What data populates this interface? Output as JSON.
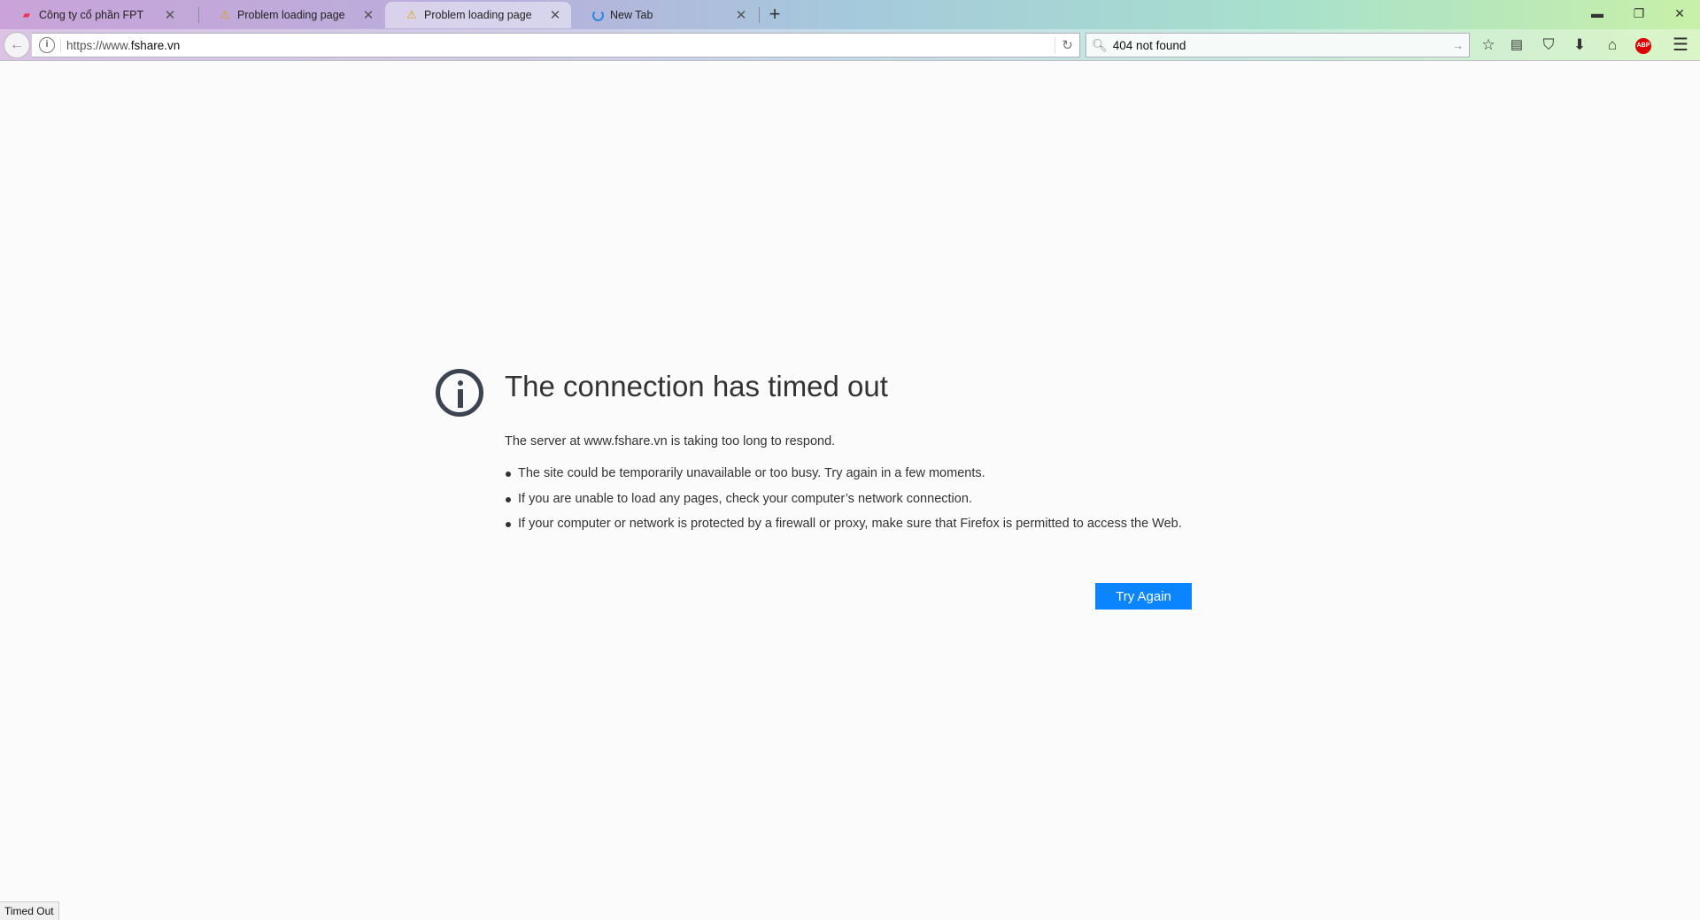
{
  "tabs": [
    {
      "label": "Công ty cổ phần FPT",
      "icon": "fpt-favicon",
      "active": false
    },
    {
      "label": "Problem loading page",
      "icon": "warning-icon",
      "active": false
    },
    {
      "label": "Problem loading page",
      "icon": "warning-icon",
      "active": true
    },
    {
      "label": "New Tab",
      "icon": "loading-spinner-icon",
      "active": false
    }
  ],
  "toolbar": {
    "url_prefix": "https://www.",
    "url_domain": "fshare.vn",
    "search_value": "404 not found"
  },
  "error": {
    "title": "The connection has timed out",
    "description": "The server at www.fshare.vn is taking too long to respond.",
    "bullets": [
      "The site could be temporarily unavailable or too busy. Try again in a few moments.",
      "If you are unable to load any pages, check your computer’s network connection.",
      "If your computer or network is protected by a firewall or proxy, make sure that Firefox is permitted to access the Web."
    ],
    "button_label": "Try Again",
    "button_color": "#0a84ff"
  },
  "status_text": "Timed Out"
}
